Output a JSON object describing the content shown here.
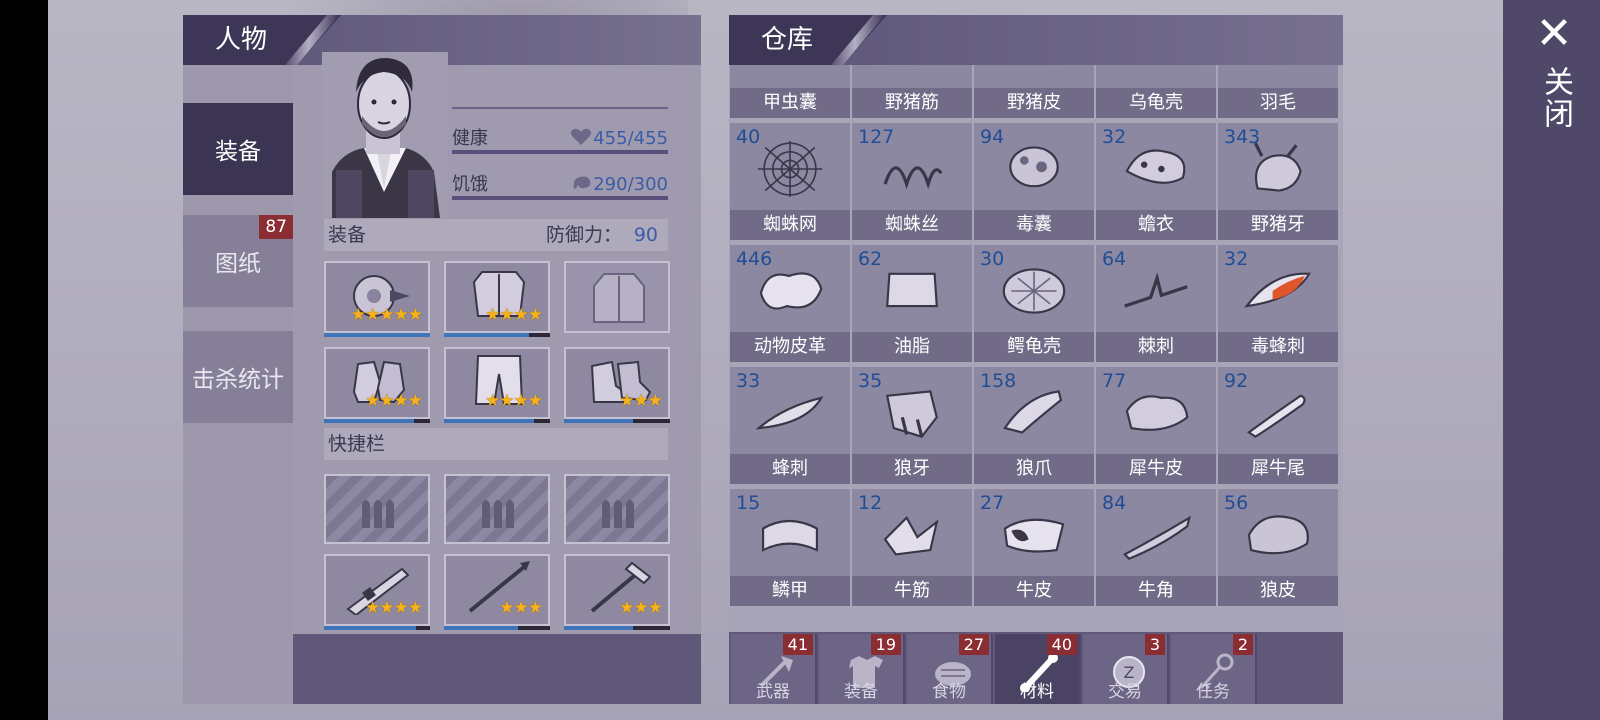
{
  "close": {
    "label": "关闭"
  },
  "character": {
    "header": "人物",
    "tabs": [
      {
        "label": "装备",
        "active": true
      },
      {
        "label": "图纸",
        "badge": "87"
      },
      {
        "label": "击杀统计"
      }
    ],
    "stats": {
      "health_label": "健康",
      "health_value": "455/455",
      "health_fraction": 1.0,
      "hunger_label": "饥饿",
      "hunger_value": "290/300",
      "hunger_fraction": 0.967
    },
    "equip_section": {
      "label": "装备",
      "defense_label": "防御力：",
      "defense_value": "90"
    },
    "equipment": [
      {
        "name": "helmet-icon",
        "stars": "★★★★★",
        "durability": 1.0
      },
      {
        "name": "body-armor-icon",
        "stars": "★★★★",
        "durability": 0.8
      },
      {
        "name": "jacket-icon",
        "stars": "",
        "durability": 0
      },
      {
        "name": "gloves-icon",
        "stars": "★★★★",
        "durability": 0.85
      },
      {
        "name": "pants-icon",
        "stars": "★★★★",
        "durability": 0.85
      },
      {
        "name": "boots-icon",
        "stars": "★★★",
        "durability": 0.65
      }
    ],
    "quickbar": {
      "label": "快捷栏",
      "slots": [
        {
          "name": "bullet-icon",
          "stars": ""
        },
        {
          "name": "bullet-icon",
          "stars": ""
        },
        {
          "name": "bullet-icon",
          "stars": ""
        },
        {
          "name": "shotgun-icon",
          "stars": "★★★★",
          "durability": 0.87
        },
        {
          "name": "spear-icon",
          "stars": "★★★",
          "durability": 0.7
        },
        {
          "name": "crossbow-icon",
          "stars": "★★★",
          "durability": 0.65
        }
      ]
    }
  },
  "warehouse": {
    "header": "仓库",
    "items": [
      {
        "count": "",
        "name": "甲虫囊"
      },
      {
        "count": "",
        "name": "野猪筋"
      },
      {
        "count": "",
        "name": "野猪皮"
      },
      {
        "count": "",
        "name": "乌龟壳"
      },
      {
        "count": "",
        "name": "羽毛"
      },
      {
        "count": "40",
        "name": "蜘蛛网"
      },
      {
        "count": "127",
        "name": "蜘蛛丝"
      },
      {
        "count": "94",
        "name": "毒囊"
      },
      {
        "count": "32",
        "name": "蟾衣"
      },
      {
        "count": "343",
        "name": "野猪牙"
      },
      {
        "count": "446",
        "name": "动物皮革"
      },
      {
        "count": "62",
        "name": "油脂"
      },
      {
        "count": "30",
        "name": "鳄龟壳"
      },
      {
        "count": "64",
        "name": "棘刺"
      },
      {
        "count": "32",
        "name": "毒蜂刺"
      },
      {
        "count": "33",
        "name": "蜂刺"
      },
      {
        "count": "35",
        "name": "狼牙"
      },
      {
        "count": "158",
        "name": "狼爪"
      },
      {
        "count": "77",
        "name": "犀牛皮"
      },
      {
        "count": "92",
        "name": "犀牛尾"
      },
      {
        "count": "15",
        "name": "鳞甲"
      },
      {
        "count": "12",
        "name": "牛筋"
      },
      {
        "count": "27",
        "name": "牛皮"
      },
      {
        "count": "84",
        "name": "牛角"
      },
      {
        "count": "56",
        "name": "狼皮"
      }
    ],
    "tabs": [
      {
        "label": "武器",
        "badge": "41",
        "icon": "axe-icon"
      },
      {
        "label": "装备",
        "badge": "19",
        "icon": "shirt-icon"
      },
      {
        "label": "食物",
        "badge": "27",
        "icon": "meat-icon"
      },
      {
        "label": "材料",
        "badge": "40",
        "icon": "bone-icon",
        "active": true
      },
      {
        "label": "交易",
        "badge": "3",
        "icon": "coin-icon"
      },
      {
        "label": "任务",
        "badge": "2",
        "icon": "key-icon"
      }
    ]
  }
}
